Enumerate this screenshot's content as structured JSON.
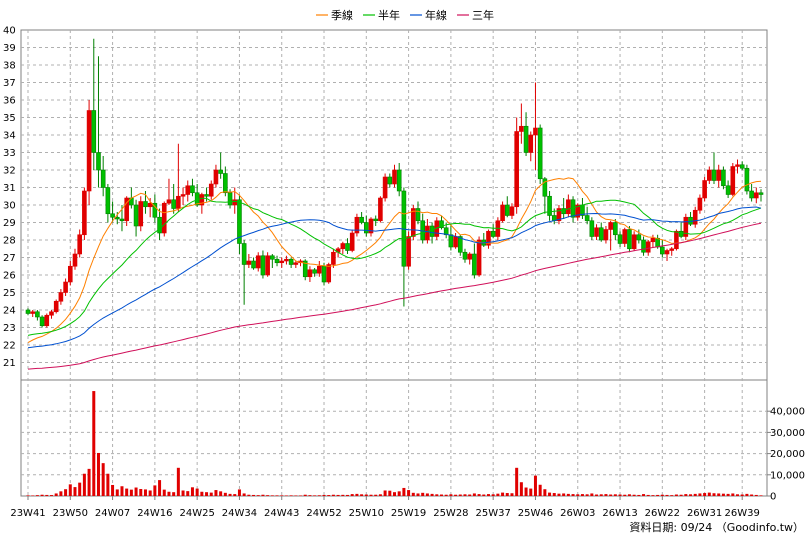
{
  "chart_data": {
    "type": "candlestick",
    "legend": {
      "placement": "top-center",
      "entries": [
        {
          "name": "季線",
          "color": "#ff8000"
        },
        {
          "name": "半年",
          "color": "#00c000"
        },
        {
          "name": "年線",
          "color": "#0050d0"
        },
        {
          "name": "三年",
          "color": "#d0105a"
        }
      ]
    },
    "price_axis": {
      "ylim": [
        20,
        40
      ],
      "ticks": [
        21,
        22,
        23,
        24,
        25,
        26,
        27,
        28,
        29,
        30,
        31,
        32,
        33,
        34,
        35,
        36,
        37,
        38,
        39,
        40
      ],
      "side": "left"
    },
    "volume_axis": {
      "ylim": [
        0,
        50000
      ],
      "ticks": [
        0,
        10000,
        20000,
        30000,
        40000
      ],
      "tick_labels": [
        "0",
        "10,000",
        "20,000",
        "30,000",
        "40,000"
      ],
      "side": "right"
    },
    "grid": true,
    "x_tick_labels": [
      {
        "label": "23W41",
        "index": 0
      },
      {
        "label": "23W50",
        "index": 9
      },
      {
        "label": "24W07",
        "index": 18
      },
      {
        "label": "24W16",
        "index": 27
      },
      {
        "label": "24W25",
        "index": 36
      },
      {
        "label": "24W34",
        "index": 45
      },
      {
        "label": "24W43",
        "index": 54
      },
      {
        "label": "24W52",
        "index": 63
      },
      {
        "label": "25W10",
        "index": 72
      },
      {
        "label": "25W19",
        "index": 81
      },
      {
        "label": "25W28",
        "index": 90
      },
      {
        "label": "25W37",
        "index": 99
      },
      {
        "label": "25W46",
        "index": 108
      },
      {
        "label": "26W03",
        "index": 117
      },
      {
        "label": "26W13",
        "index": 126
      },
      {
        "label": "26W22",
        "index": 135
      },
      {
        "label": "26W31",
        "index": 144
      },
      {
        "label": "26W39",
        "index": 152
      }
    ],
    "candles": [
      [
        24.0,
        24.1,
        23.7,
        23.8,
        300
      ],
      [
        23.8,
        24.0,
        23.6,
        23.9,
        250
      ],
      [
        23.9,
        24.0,
        23.4,
        23.6,
        400
      ],
      [
        23.6,
        23.7,
        23.0,
        23.1,
        600
      ],
      [
        23.1,
        23.8,
        23.0,
        23.7,
        500
      ],
      [
        23.7,
        24.0,
        23.5,
        23.9,
        450
      ],
      [
        23.9,
        24.6,
        23.8,
        24.5,
        1200
      ],
      [
        24.5,
        25.2,
        24.3,
        25.0,
        2200
      ],
      [
        25.0,
        25.8,
        24.8,
        25.6,
        3200
      ],
      [
        25.6,
        26.8,
        25.4,
        26.5,
        5500
      ],
      [
        26.5,
        27.5,
        26.3,
        27.2,
        4200
      ],
      [
        27.2,
        28.6,
        27.0,
        28.3,
        6300
      ],
      [
        28.3,
        31.0,
        28.0,
        30.8,
        10500
      ],
      [
        30.8,
        36.0,
        30.0,
        35.4,
        12800
      ],
      [
        35.4,
        39.5,
        32.0,
        33.0,
        49500
      ],
      [
        33.0,
        38.5,
        31.0,
        32.0,
        20300
      ],
      [
        32.0,
        32.8,
        30.5,
        31.0,
        15500
      ],
      [
        31.0,
        31.2,
        29.0,
        29.5,
        10500
      ],
      [
        29.5,
        30.2,
        29.0,
        29.3,
        5200
      ],
      [
        29.3,
        29.6,
        28.9,
        29.2,
        3100
      ],
      [
        29.2,
        30.0,
        28.5,
        29.1,
        4600
      ],
      [
        29.1,
        30.5,
        28.8,
        30.4,
        3500
      ],
      [
        30.4,
        31.0,
        29.8,
        30.0,
        3000
      ],
      [
        30.0,
        30.3,
        28.2,
        28.8,
        4000
      ],
      [
        28.8,
        30.5,
        28.5,
        30.2,
        3300
      ],
      [
        30.2,
        30.8,
        29.5,
        29.9,
        3100
      ],
      [
        29.9,
        30.4,
        29.3,
        30.1,
        2600
      ],
      [
        30.1,
        30.6,
        29.0,
        29.3,
        5000
      ],
      [
        29.3,
        29.8,
        28.0,
        28.4,
        7500
      ],
      [
        28.4,
        30.2,
        28.2,
        30.1,
        3000
      ],
      [
        30.1,
        31.5,
        30.0,
        30.3,
        2000
      ],
      [
        30.3,
        31.2,
        29.5,
        29.8,
        1800
      ],
      [
        29.8,
        33.5,
        29.6,
        30.5,
        13300
      ],
      [
        30.5,
        31.0,
        30.0,
        30.6,
        2600
      ],
      [
        30.6,
        31.4,
        30.2,
        31.1,
        2300
      ],
      [
        31.1,
        31.5,
        30.5,
        30.7,
        4100
      ],
      [
        30.7,
        31.2,
        29.9,
        30.0,
        3500
      ],
      [
        30.0,
        30.7,
        29.5,
        30.6,
        2000
      ],
      [
        30.6,
        31.0,
        30.2,
        30.5,
        1800
      ],
      [
        30.5,
        31.4,
        30.3,
        31.2,
        1600
      ],
      [
        31.2,
        32.3,
        31.0,
        32.0,
        2800
      ],
      [
        32.0,
        33.0,
        31.5,
        31.8,
        2200
      ],
      [
        31.8,
        32.2,
        30.5,
        30.7,
        1500
      ],
      [
        30.7,
        30.9,
        29.8,
        30.0,
        1000
      ],
      [
        30.0,
        31.0,
        29.5,
        30.3,
        900
      ],
      [
        30.3,
        30.6,
        27.2,
        27.8,
        3100
      ],
      [
        27.8,
        28.0,
        24.3,
        26.6,
        1200
      ],
      [
        26.6,
        27.2,
        26.4,
        26.8,
        600
      ],
      [
        26.8,
        27.0,
        26.3,
        26.4,
        500
      ],
      [
        26.4,
        27.3,
        26.2,
        27.1,
        400
      ],
      [
        27.1,
        27.4,
        25.8,
        26.0,
        600
      ],
      [
        26.0,
        27.3,
        25.9,
        27.1,
        400
      ],
      [
        27.1,
        27.2,
        26.4,
        26.9,
        300
      ],
      [
        26.9,
        27.1,
        26.5,
        26.7,
        300
      ],
      [
        26.7,
        27.0,
        26.4,
        26.8,
        300
      ],
      [
        26.8,
        27.1,
        26.6,
        26.9,
        250
      ],
      [
        26.9,
        27.0,
        26.4,
        26.6,
        300
      ],
      [
        26.6,
        26.8,
        26.4,
        26.7,
        250
      ],
      [
        26.7,
        26.9,
        26.5,
        26.8,
        250
      ],
      [
        26.8,
        26.9,
        25.7,
        25.9,
        600
      ],
      [
        25.9,
        26.5,
        25.6,
        26.3,
        400
      ],
      [
        26.3,
        26.4,
        25.9,
        26.1,
        300
      ],
      [
        26.1,
        26.8,
        25.9,
        26.5,
        350
      ],
      [
        26.5,
        26.7,
        25.4,
        25.6,
        500
      ],
      [
        25.6,
        26.7,
        25.5,
        26.6,
        450
      ],
      [
        26.6,
        27.5,
        26.4,
        27.3,
        600
      ],
      [
        27.3,
        27.6,
        27.0,
        27.5,
        500
      ],
      [
        27.5,
        27.9,
        27.2,
        27.8,
        550
      ],
      [
        27.8,
        28.1,
        27.2,
        27.4,
        500
      ],
      [
        27.4,
        28.6,
        27.3,
        28.4,
        900
      ],
      [
        28.4,
        29.5,
        28.2,
        29.3,
        1000
      ],
      [
        29.3,
        29.6,
        28.9,
        29.0,
        800
      ],
      [
        29.0,
        29.4,
        28.2,
        28.4,
        700
      ],
      [
        28.4,
        29.3,
        28.2,
        29.2,
        600
      ],
      [
        29.2,
        29.4,
        28.8,
        29.1,
        600
      ],
      [
        29.1,
        30.5,
        29.0,
        30.4,
        800
      ],
      [
        30.4,
        31.8,
        30.2,
        31.6,
        2600
      ],
      [
        31.6,
        31.8,
        31.0,
        31.2,
        2500
      ],
      [
        31.2,
        32.3,
        31.0,
        32.0,
        1800
      ],
      [
        32.0,
        32.4,
        30.5,
        30.8,
        2200
      ],
      [
        30.8,
        31.0,
        24.2,
        26.5,
        3800
      ],
      [
        26.5,
        28.5,
        26.3,
        28.2,
        2800
      ],
      [
        28.2,
        30.0,
        28.0,
        29.8,
        1500
      ],
      [
        29.8,
        30.2,
        28.9,
        29.1,
        1200
      ],
      [
        29.1,
        29.5,
        27.8,
        28.0,
        1500
      ],
      [
        28.0,
        29.2,
        27.8,
        28.8,
        1200
      ],
      [
        28.8,
        29.0,
        27.8,
        28.2,
        1000
      ],
      [
        28.2,
        29.3,
        28.0,
        29.1,
        800
      ],
      [
        29.1,
        29.4,
        28.6,
        28.7,
        700
      ],
      [
        28.7,
        29.0,
        28.1,
        28.3,
        600
      ],
      [
        28.3,
        28.9,
        27.4,
        27.6,
        800
      ],
      [
        27.6,
        28.4,
        27.5,
        28.2,
        600
      ],
      [
        28.2,
        28.3,
        27.1,
        27.3,
        700
      ],
      [
        27.3,
        27.5,
        26.7,
        26.9,
        800
      ],
      [
        26.9,
        27.3,
        26.6,
        27.2,
        700
      ],
      [
        27.2,
        27.8,
        25.8,
        26.0,
        1200
      ],
      [
        26.0,
        28.2,
        25.9,
        28.0,
        900
      ],
      [
        28.0,
        28.4,
        27.6,
        27.7,
        700
      ],
      [
        27.7,
        28.6,
        27.5,
        28.5,
        900
      ],
      [
        28.5,
        28.9,
        28.1,
        28.2,
        800
      ],
      [
        28.2,
        29.3,
        28.0,
        29.1,
        1100
      ],
      [
        29.1,
        30.2,
        29.0,
        30.0,
        1600
      ],
      [
        30.0,
        30.5,
        29.3,
        29.4,
        1400
      ],
      [
        29.4,
        30.1,
        29.2,
        29.9,
        1300
      ],
      [
        29.9,
        35.0,
        29.5,
        34.2,
        13300
      ],
      [
        34.2,
        35.8,
        33.5,
        34.5,
        6500
      ],
      [
        34.5,
        35.3,
        32.8,
        33.0,
        4000
      ],
      [
        33.0,
        34.2,
        32.5,
        34.0,
        3500
      ],
      [
        34.0,
        37.0,
        32.0,
        34.4,
        9600
      ],
      [
        34.4,
        34.6,
        31.2,
        31.5,
        5300
      ],
      [
        31.5,
        31.6,
        29.5,
        30.5,
        3200
      ],
      [
        30.5,
        30.8,
        29.1,
        29.4,
        1600
      ],
      [
        29.4,
        29.8,
        28.9,
        29.1,
        1400
      ],
      [
        29.1,
        30.0,
        28.9,
        29.8,
        1100
      ],
      [
        29.8,
        30.4,
        29.2,
        29.5,
        1200
      ],
      [
        29.5,
        30.6,
        29.3,
        30.3,
        1000
      ],
      [
        30.3,
        30.5,
        29.0,
        29.3,
        900
      ],
      [
        29.3,
        30.1,
        29.1,
        30.0,
        800
      ],
      [
        30.0,
        30.4,
        29.2,
        29.4,
        900
      ],
      [
        29.4,
        29.9,
        28.9,
        29.1,
        800
      ],
      [
        29.1,
        29.3,
        28.0,
        28.2,
        1200
      ],
      [
        28.2,
        28.9,
        28.0,
        28.7,
        700
      ],
      [
        28.7,
        29.0,
        27.9,
        28.0,
        800
      ],
      [
        28.0,
        28.8,
        27.8,
        28.6,
        900
      ],
      [
        28.6,
        29.1,
        27.4,
        29.0,
        700
      ],
      [
        29.0,
        29.2,
        28.0,
        28.3,
        800
      ],
      [
        28.3,
        28.5,
        27.6,
        27.8,
        700
      ],
      [
        27.8,
        28.7,
        27.6,
        28.6,
        600
      ],
      [
        28.6,
        28.8,
        27.3,
        27.5,
        800
      ],
      [
        27.5,
        28.5,
        27.4,
        28.3,
        600
      ],
      [
        28.3,
        28.6,
        27.8,
        28.0,
        500
      ],
      [
        28.0,
        28.2,
        27.1,
        27.3,
        900
      ],
      [
        27.3,
        28.0,
        27.1,
        27.9,
        500
      ],
      [
        27.9,
        28.3,
        27.6,
        28.1,
        400
      ],
      [
        28.1,
        28.3,
        27.5,
        27.6,
        500
      ],
      [
        27.6,
        28.0,
        27.0,
        27.2,
        600
      ],
      [
        27.2,
        27.5,
        26.8,
        27.4,
        500
      ],
      [
        27.4,
        27.6,
        27.1,
        27.5,
        400
      ],
      [
        27.5,
        28.6,
        27.4,
        28.5,
        700
      ],
      [
        28.5,
        29.0,
        28.1,
        28.2,
        600
      ],
      [
        28.2,
        29.5,
        28.0,
        29.3,
        900
      ],
      [
        29.3,
        29.6,
        28.8,
        28.9,
        800
      ],
      [
        28.9,
        29.9,
        28.7,
        29.7,
        1000
      ],
      [
        29.7,
        30.6,
        29.5,
        30.4,
        1200
      ],
      [
        30.4,
        31.6,
        30.2,
        31.4,
        1400
      ],
      [
        31.4,
        32.2,
        31.2,
        32.0,
        1600
      ],
      [
        32.0,
        33.0,
        31.2,
        31.4,
        1300
      ],
      [
        31.4,
        32.3,
        31.0,
        32.0,
        1200
      ],
      [
        32.0,
        32.2,
        30.9,
        31.1,
        1100
      ],
      [
        31.1,
        31.4,
        30.4,
        30.6,
        1000
      ],
      [
        30.6,
        32.4,
        30.5,
        32.2,
        1200
      ],
      [
        32.2,
        32.6,
        31.8,
        32.3,
        800
      ],
      [
        32.3,
        32.5,
        32.0,
        32.1,
        700
      ],
      [
        32.1,
        32.3,
        30.6,
        30.8,
        1000
      ],
      [
        30.8,
        31.2,
        30.2,
        30.4,
        700
      ],
      [
        30.4,
        31.0,
        30.1,
        30.7,
        500
      ],
      [
        30.7,
        30.9,
        30.2,
        30.6,
        300
      ]
    ],
    "source_text": "資料日期: 09/24 （Goodinfo.tw）"
  }
}
